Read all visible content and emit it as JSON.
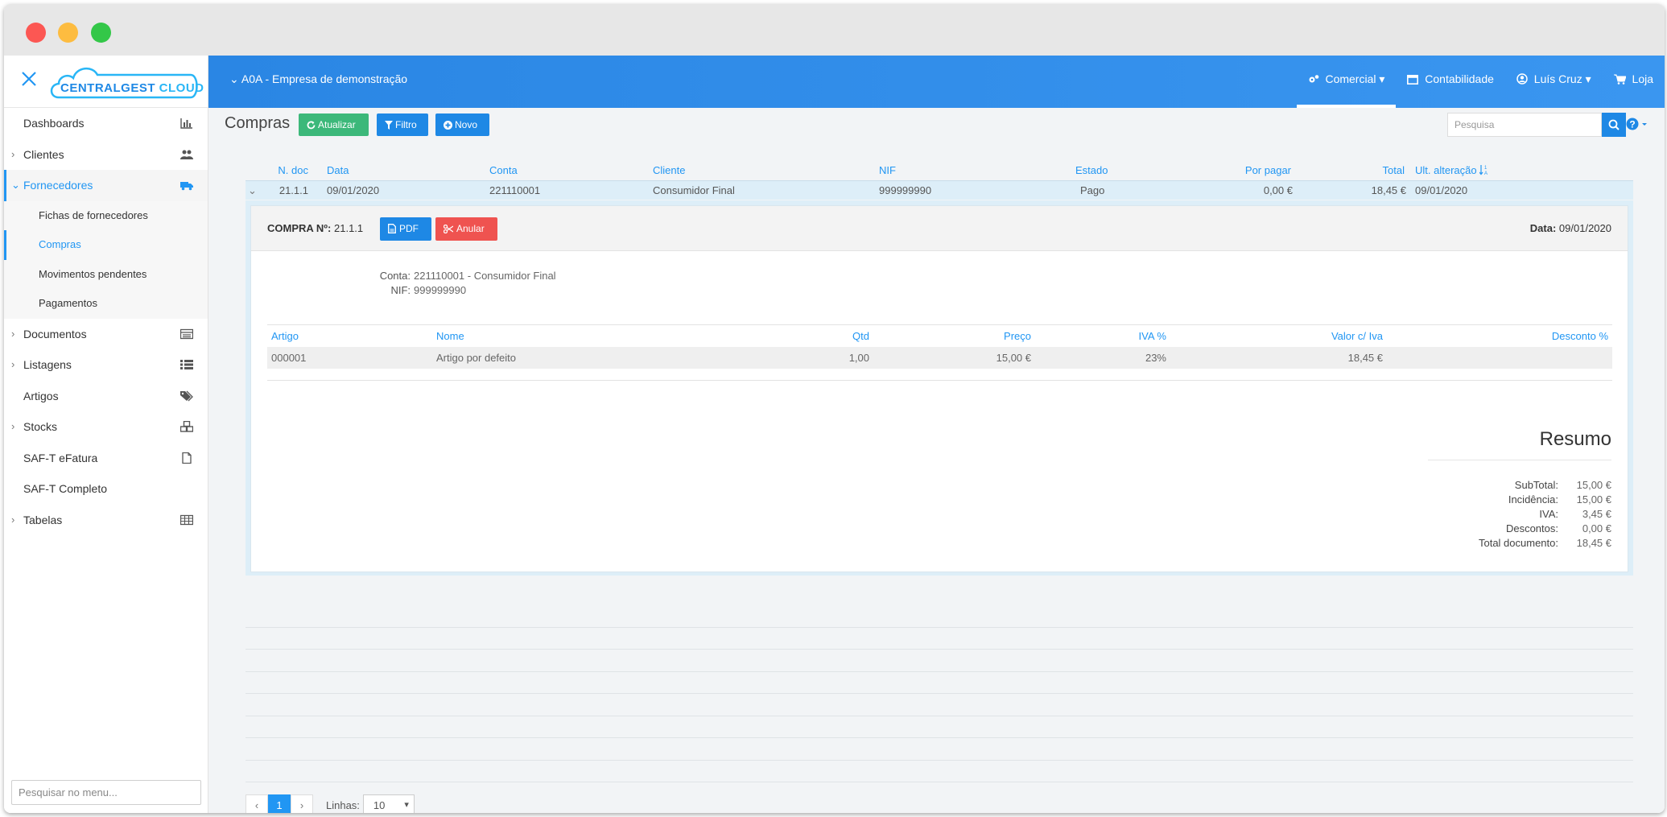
{
  "app": {
    "brand_a": "CENTRALGEST",
    "brand_b": "CLOUD",
    "company": "A0A - Empresa de demonstração"
  },
  "topnav": {
    "comercial": "Comercial",
    "contabilidade": "Contabilidade",
    "user": "Luís Cruz",
    "loja": "Loja"
  },
  "sidebar": {
    "items": [
      {
        "label": "Dashboards"
      },
      {
        "label": "Clientes"
      },
      {
        "label": "Fornecedores"
      },
      {
        "label": "Fichas de fornecedores"
      },
      {
        "label": "Compras"
      },
      {
        "label": "Movimentos pendentes"
      },
      {
        "label": "Pagamentos"
      },
      {
        "label": "Documentos"
      },
      {
        "label": "Listagens"
      },
      {
        "label": "Artigos"
      },
      {
        "label": "Stocks"
      },
      {
        "label": "SAF-T eFatura"
      },
      {
        "label": "SAF-T Completo"
      },
      {
        "label": "Tabelas"
      }
    ],
    "search_placeholder": "Pesquisar no menu..."
  },
  "toolbar": {
    "title": "Compras",
    "atualizar": "Atualizar",
    "filtro": "Filtro",
    "novo": "Novo",
    "search_placeholder": "Pesquisa"
  },
  "grid": {
    "headers": {
      "ndoc": "N. doc",
      "data": "Data",
      "conta": "Conta",
      "cliente": "Cliente",
      "nif": "NIF",
      "estado": "Estado",
      "porpagar": "Por pagar",
      "total": "Total",
      "ultalt": "Ult. alteração"
    },
    "row": {
      "ndoc": "21.1.1",
      "data": "09/01/2020",
      "conta": "221110001",
      "cliente": "Consumidor Final",
      "nif": "999999990",
      "estado": "Pago",
      "porpagar": "0,00 €",
      "total": "18,45 €",
      "ultalt": "09/01/2020"
    }
  },
  "detail": {
    "title_label": "COMPRA Nº:",
    "title_value": "21.1.1",
    "pdf": "PDF",
    "anular": "Anular",
    "date_label": "Data:",
    "date_value": "09/01/2020",
    "conta_label": "Conta:",
    "conta_value": "221110001 - Consumidor Final",
    "nif_label": "NIF:",
    "nif_value": "999999990",
    "lines_headers": {
      "artigo": "Artigo",
      "nome": "Nome",
      "qtd": "Qtd",
      "preco": "Preço",
      "iva": "IVA %",
      "valor": "Valor c/ Iva",
      "desconto": "Desconto %"
    },
    "line": {
      "artigo": "000001",
      "nome": "Artigo por defeito",
      "qtd": "1,00",
      "preco": "15,00 €",
      "iva": "23%",
      "valor": "18,45 €",
      "desconto": ""
    },
    "resumo": {
      "title": "Resumo",
      "subtotal_label": "SubTotal:",
      "subtotal": "15,00 €",
      "incidencia_label": "Incidência:",
      "incidencia": "15,00 €",
      "iva_label": "IVA:",
      "iva": "3,45 €",
      "descontos_label": "Descontos:",
      "descontos": "0,00 €",
      "total_label": "Total documento:",
      "total": "18,45 €"
    }
  },
  "pager": {
    "prev": "‹",
    "page": "1",
    "next": "›",
    "lines_label": "Linhas:",
    "lines_value": "10"
  },
  "colors": {
    "accent": "#2196f3",
    "topbar": "#2a86e4",
    "success": "#3cb87a",
    "danger": "#ef5350"
  }
}
